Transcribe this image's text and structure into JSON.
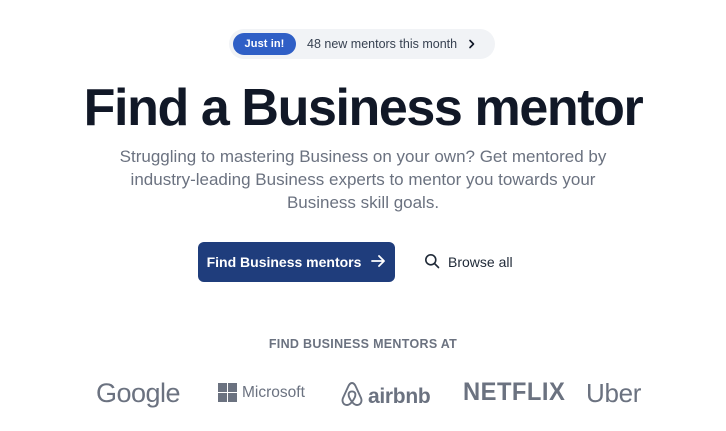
{
  "announcement": {
    "badge": "Just in!",
    "text": "48 new mentors this month",
    "icon": "chevron-right-icon"
  },
  "hero": {
    "title": "Find a Business mentor",
    "subtitle": "Struggling to mastering Business on your own? Get mentored by industry-leading Business experts to mentor you towards your Business skill goals."
  },
  "actions": {
    "primary_label": "Find Business mentors",
    "primary_icon": "arrow-right-icon",
    "secondary_label": "Browse all",
    "secondary_icon": "search-icon"
  },
  "companies": {
    "heading": "FIND BUSINESS MENTORS AT",
    "logos": [
      "Google",
      "Microsoft",
      "airbnb",
      "NETFLIX",
      "Uber"
    ]
  },
  "colors": {
    "primary": "#1f3d7c",
    "badge": "#2f5fc6",
    "muted": "#6b7280",
    "heading": "#111827"
  }
}
